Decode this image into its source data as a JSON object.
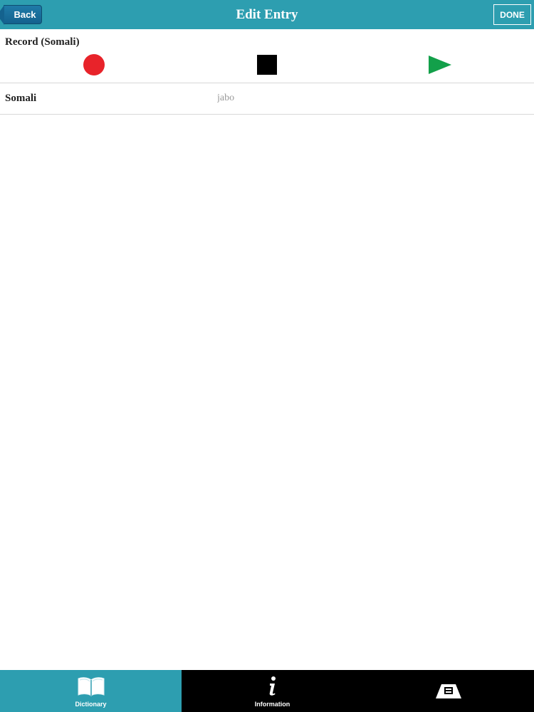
{
  "navbar": {
    "back_label": "Back",
    "title": "Edit Entry",
    "done_label": "DONE"
  },
  "record": {
    "label": "Record (Somali)"
  },
  "somali": {
    "label": "Somali",
    "value": "jabo"
  },
  "tabbar": {
    "tabs": [
      {
        "label": "Dictionary",
        "icon": "book-icon",
        "active": true
      },
      {
        "label": "Information",
        "icon": "info-icon",
        "active": false
      },
      {
        "label": "",
        "icon": "about-logo-icon",
        "active": false
      }
    ]
  },
  "colors": {
    "accent": "#2d9eb0",
    "back_button": "#14628e",
    "record": "#e8232a",
    "stop": "#000000",
    "play": "#13a04a",
    "tabbar": "#000000"
  }
}
